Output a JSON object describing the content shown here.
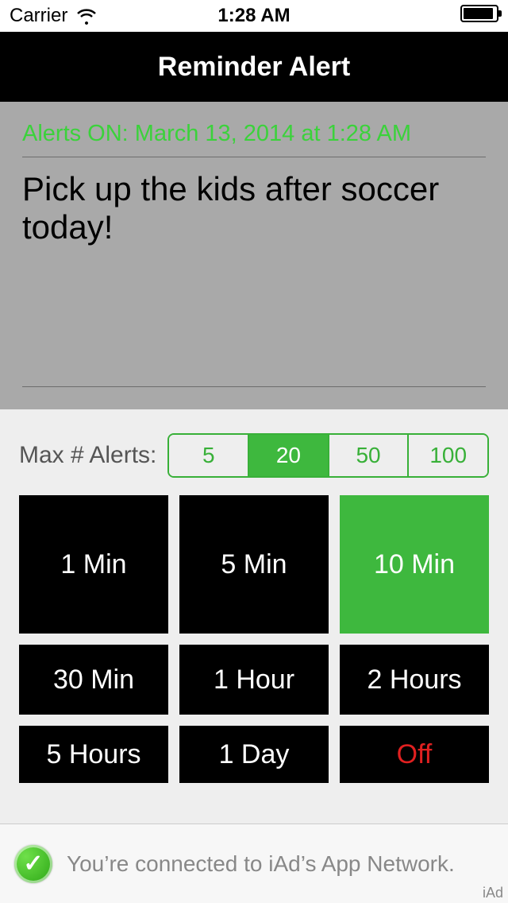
{
  "statusBar": {
    "carrier": "Carrier",
    "time": "1:28 AM"
  },
  "nav": {
    "title": "Reminder Alert"
  },
  "alert": {
    "status": "Alerts ON: March 13, 2014 at 1:28 AM",
    "text": "Pick up the kids after soccer today!"
  },
  "maxAlerts": {
    "label": "Max # Alerts:",
    "options": [
      "5",
      "20",
      "50",
      "100"
    ],
    "selected": "20"
  },
  "intervals": {
    "row1": [
      "1 Min",
      "5 Min",
      "10 Min"
    ],
    "row2": [
      "30 Min",
      "1 Hour",
      "2 Hours"
    ],
    "row3": [
      "5 Hours",
      "1 Day",
      "Off"
    ],
    "selected": "10 Min"
  },
  "ad": {
    "text": "You’re connected to iAd’s App Network.",
    "label": "iAd"
  }
}
